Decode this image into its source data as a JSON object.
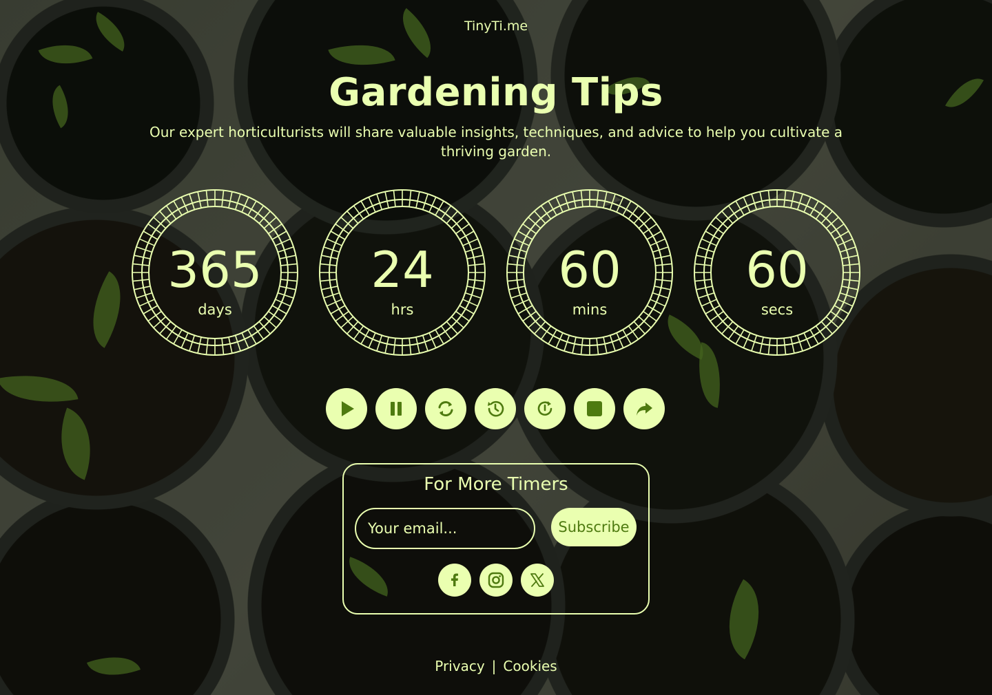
{
  "brand": "TinyTi.me",
  "title": "Gardening Tips",
  "subtitle": "Our expert horticulturists will share valuable insights, techniques, and advice to help you cultivate a thriving garden.",
  "timers": [
    {
      "value": "365",
      "unit": "days"
    },
    {
      "value": "24",
      "unit": "hrs"
    },
    {
      "value": "60",
      "unit": "mins"
    },
    {
      "value": "60",
      "unit": "secs"
    }
  ],
  "controls": [
    "play-icon",
    "pause-icon",
    "refresh-icon",
    "history-icon",
    "restart-icon",
    "stop-icon",
    "share-icon"
  ],
  "newsletter": {
    "title": "For More Timers",
    "email_placeholder": "Your email...",
    "subscribe_label": "Subscribe"
  },
  "social": [
    "facebook-icon",
    "instagram-icon",
    "x-icon"
  ],
  "footer": {
    "privacy": "Privacy",
    "separator": "|",
    "cookies": "Cookies"
  },
  "colors": {
    "accent": "#eaffb0",
    "accent_dark": "#4e7a10",
    "overlay": "#1e2416"
  }
}
